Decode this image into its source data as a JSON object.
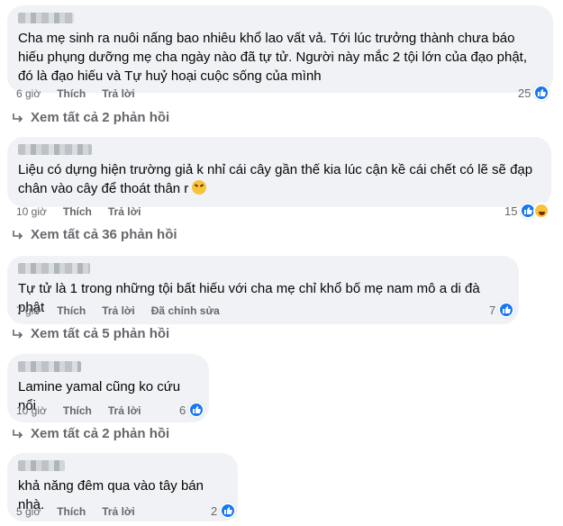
{
  "comments": [
    {
      "text": "Cha mẹ sinh ra nuôi nấng bao nhiêu khổ lao vất vả. Tới lúc trưởng thành chưa báo hiếu phụng dưỡng mẹ cha ngày nào đã tự tử. Người này mắc 2 tội lớn của đạo phật, đó là đạo hiếu và Tự huỷ hoại cuộc sống của mình",
      "time": "6 giờ",
      "like_label": "Thích",
      "reply_label": "Trả lời",
      "edited_label": "",
      "reaction_count": "25",
      "view_replies": "Xem tất cả 2 phản hồi"
    },
    {
      "text": "Liệu có dựng hiện trường giả k nhỉ cái cây gần thế kia lúc cận kề cái chết có lẽ sẽ đạp chân vào cây để thoát thân r",
      "time": "10 giờ",
      "like_label": "Thích",
      "reply_label": "Trả lời",
      "edited_label": "",
      "reaction_count": "15",
      "view_replies": "Xem tất cả 36 phản hồi"
    },
    {
      "text": "Tự tử là 1 trong những tội bất hiếu với cha mẹ chỉ khổ bố mẹ nam mô a di đà phật",
      "time": "7 giờ",
      "like_label": "Thích",
      "reply_label": "Trả lời",
      "edited_label": "Đã chỉnh sửa",
      "reaction_count": "7",
      "view_replies": "Xem tất cả 5 phản hồi"
    },
    {
      "text": "Lamine yamal cũng ko cứu nổi",
      "time": "10 giờ",
      "like_label": "Thích",
      "reply_label": "Trả lời",
      "edited_label": "",
      "reaction_count": "6",
      "view_replies": "Xem tất cả 2 phản hồi"
    },
    {
      "text": "khả năng đêm qua vào tây bán nhà.",
      "time": "5 giờ",
      "like_label": "Thích",
      "reply_label": "Trả lời",
      "edited_label": "",
      "reaction_count": "2",
      "view_replies": ""
    }
  ],
  "icons": {
    "like": "like-icon",
    "haha": "haha-icon",
    "reply": "reply-arrow-icon",
    "emoji": "tired-face-emoji"
  },
  "colors": {
    "bubble": "#f0f2f5",
    "meta": "#65676b",
    "like_blue": "#1877f2"
  }
}
